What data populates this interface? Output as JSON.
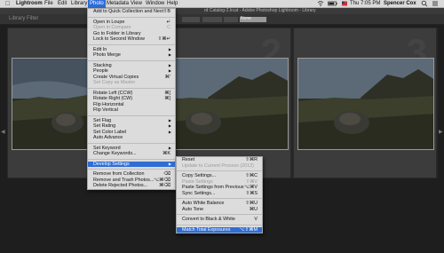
{
  "menubar": {
    "apple": "",
    "app": "Lightroom",
    "items": [
      "File",
      "Edit",
      "Library",
      "Photo",
      "Metadata",
      "View",
      "Window",
      "Help"
    ],
    "status": {
      "time": "Thu 7:05 PM",
      "user": "Spencer Cox"
    }
  },
  "window": {
    "title": "rd Catalog-2.lrcat - Adobe Photoshop Lightroom - Library"
  },
  "toolbar": {
    "library_label": "Library Filter",
    "lens_label": "None"
  },
  "grid": {
    "cell_numbers": [
      "",
      "2",
      "3"
    ]
  },
  "photo_menu": {
    "items": [
      {
        "label": "Add to Quick Collection and Next",
        "shortcut": "⇧B",
        "state": "normal"
      },
      {
        "sep": true
      },
      {
        "label": "Open in Loupe",
        "shortcut": "↵",
        "state": "normal"
      },
      {
        "label": "Open in Compare",
        "shortcut": "C",
        "state": "disabled"
      },
      {
        "label": "Go to Folder in Library",
        "shortcut": "",
        "state": "normal"
      },
      {
        "label": "Lock to Second Window",
        "shortcut": "⇧⌘↵",
        "state": "normal"
      },
      {
        "sep": true
      },
      {
        "label": "Edit In",
        "shortcut": "",
        "state": "normal",
        "submenu": true
      },
      {
        "label": "Photo Merge",
        "shortcut": "",
        "state": "normal",
        "submenu": true
      },
      {
        "sep": true
      },
      {
        "label": "Stacking",
        "shortcut": "",
        "state": "normal",
        "submenu": true
      },
      {
        "label": "People",
        "shortcut": "",
        "state": "normal",
        "submenu": true
      },
      {
        "label": "Create Virtual Copies",
        "shortcut": "⌘'",
        "state": "normal"
      },
      {
        "label": "Set Copy as Master",
        "shortcut": "",
        "state": "disabled"
      },
      {
        "sep": true
      },
      {
        "label": "Rotate Left (CCW)",
        "shortcut": "⌘[",
        "state": "normal"
      },
      {
        "label": "Rotate Right (CW)",
        "shortcut": "⌘]",
        "state": "normal"
      },
      {
        "label": "Flip Horizontal",
        "shortcut": "",
        "state": "normal"
      },
      {
        "label": "Flip Vertical",
        "shortcut": "",
        "state": "normal"
      },
      {
        "sep": true
      },
      {
        "label": "Set Flag",
        "shortcut": "",
        "state": "normal",
        "submenu": true
      },
      {
        "label": "Set Rating",
        "shortcut": "",
        "state": "normal",
        "submenu": true
      },
      {
        "label": "Set Color Label",
        "shortcut": "",
        "state": "normal",
        "submenu": true
      },
      {
        "label": "Auto Advance",
        "shortcut": "",
        "state": "normal"
      },
      {
        "sep": true
      },
      {
        "label": "Set Keyword",
        "shortcut": "",
        "state": "normal",
        "submenu": true
      },
      {
        "label": "Change Keywords...",
        "shortcut": "⌘K",
        "state": "normal"
      },
      {
        "sep": true
      },
      {
        "label": "Develop Settings",
        "shortcut": "",
        "state": "highlighted",
        "submenu": true
      },
      {
        "sep": true
      },
      {
        "label": "Remove from Collection",
        "shortcut": "⌫",
        "state": "normal"
      },
      {
        "label": "Remove and Trash Photos...",
        "shortcut": "⌥⌘⌫",
        "state": "normal"
      },
      {
        "label": "Delete Rejected Photos...",
        "shortcut": "⌘⌫",
        "state": "normal"
      }
    ]
  },
  "develop_submenu": {
    "items": [
      {
        "label": "Reset",
        "shortcut": "⇧⌘R",
        "state": "normal"
      },
      {
        "label": "Update to Current Process (2012)",
        "shortcut": "",
        "state": "disabled"
      },
      {
        "sep": true
      },
      {
        "label": "Copy Settings...",
        "shortcut": "⇧⌘C",
        "state": "normal"
      },
      {
        "label": "Paste Settings",
        "shortcut": "⇧⌘V",
        "state": "disabled"
      },
      {
        "label": "Paste Settings from Previous",
        "shortcut": "⌥⌘V",
        "state": "normal"
      },
      {
        "label": "Sync Settings...",
        "shortcut": "⇧⌘S",
        "state": "normal"
      },
      {
        "sep": true
      },
      {
        "label": "Auto White Balance",
        "shortcut": "⇧⌘U",
        "state": "normal"
      },
      {
        "label": "Auto Tone",
        "shortcut": "⌘U",
        "state": "normal"
      },
      {
        "sep": true
      },
      {
        "label": "Convert to Black & White",
        "shortcut": "V",
        "state": "normal"
      },
      {
        "sep": true
      },
      {
        "label": "Match Total Exposures",
        "shortcut": "⌥⇧⌘M",
        "state": "highlighted"
      }
    ]
  }
}
